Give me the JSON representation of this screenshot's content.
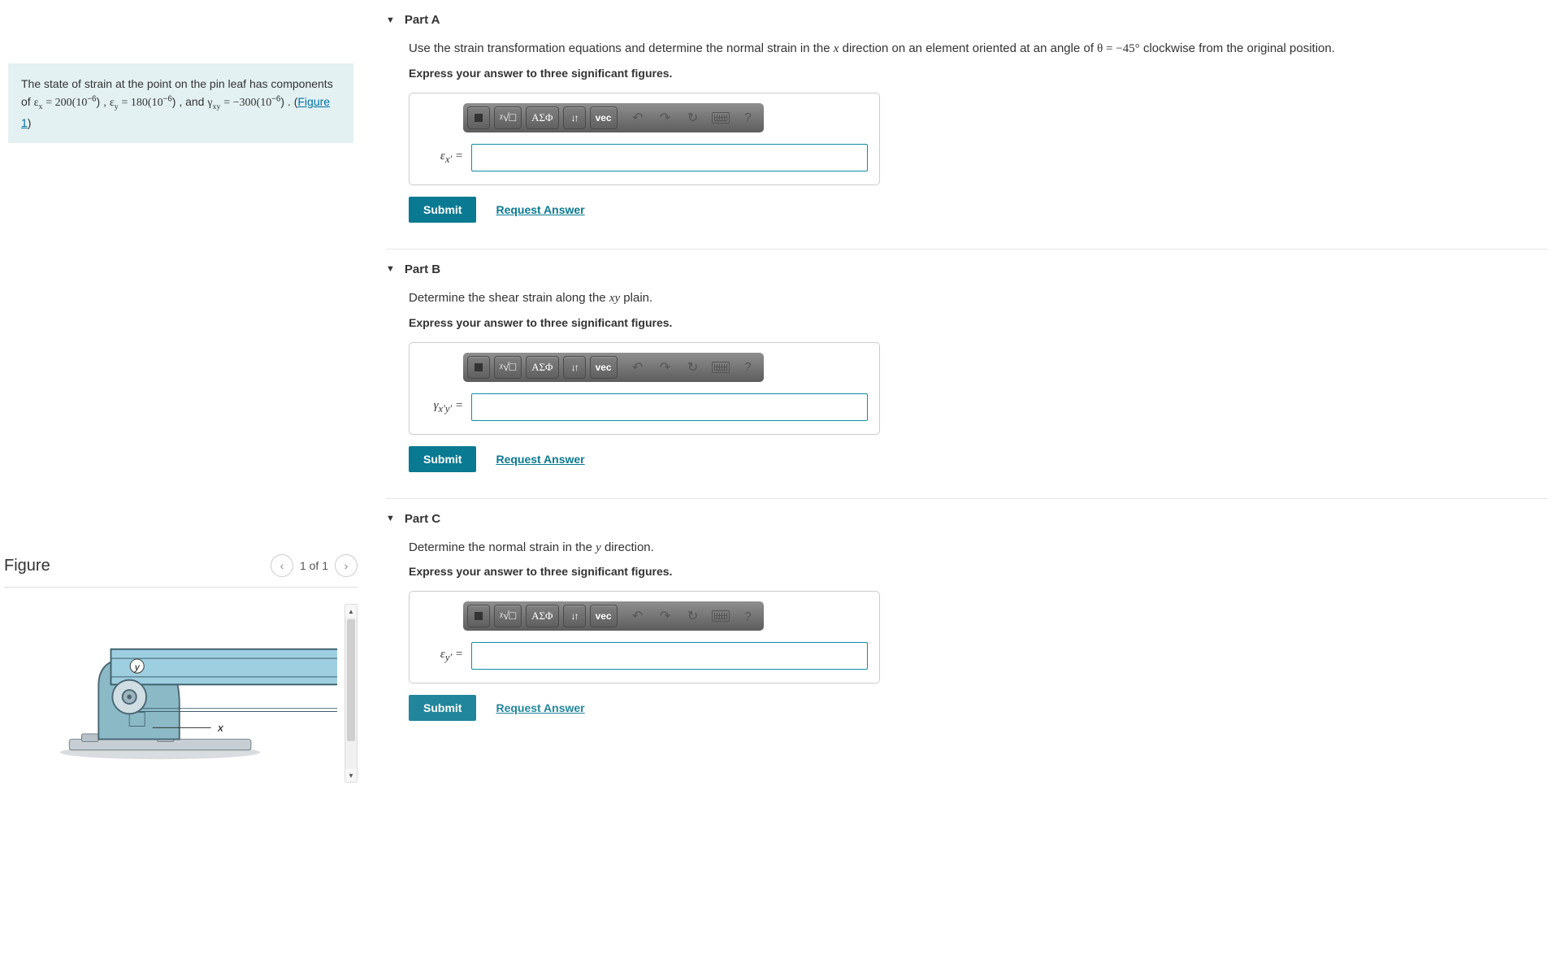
{
  "problem": {
    "intro": "The state of strain at the point on the pin leaf has components of ",
    "eps_x_var": "ε",
    "eps_x_sub": "x",
    "eps_x_eq": " = 200(10",
    "exp_neg6": "−6",
    "close_paren": ")",
    "sep1": " , ",
    "eps_y_var": "ε",
    "eps_y_sub": "y",
    "eps_y_eq": " = 180(10",
    "sep2": " , and ",
    "gamma_var": "γ",
    "gamma_sub": "xy",
    "gamma_eq": " = −300(10",
    "trail": " . (",
    "figure_link": "Figure 1",
    "trail_close": ")"
  },
  "figure_panel": {
    "title": "Figure",
    "pager": "1 of 1",
    "axes": {
      "x": "x",
      "y": "y"
    }
  },
  "parts": {
    "a": {
      "header": "Part A",
      "prompt_pre": "Use the strain transformation equations and determine the normal strain in the ",
      "prompt_var1": "x",
      "prompt_mid": " direction on an element oriented at an angle of ",
      "prompt_theta": "θ = −45°",
      "prompt_post": " clockwise from the original position.",
      "instruct": "Express your answer to three significant figures.",
      "symlabel_html": "ε<sub>x′</sub> ="
    },
    "b": {
      "header": "Part B",
      "prompt_pre": "Determine the shear strain along the ",
      "prompt_var1": "xy",
      "prompt_post": " plain.",
      "instruct": "Express your answer to three significant figures.",
      "symlabel_html": "γ<sub>x′y′</sub> ="
    },
    "c": {
      "header": "Part C",
      "prompt_pre": "Determine the normal strain in the ",
      "prompt_var1": "y",
      "prompt_post": " direction.",
      "instruct": "Express your answer to three significant figures.",
      "symlabel_html": "ε<sub>y′</sub> ="
    }
  },
  "toolbar": {
    "templates": "■",
    "sqrt": "ᵡ√□",
    "greek": "ΑΣΦ",
    "subscript": "↓↑",
    "vec": "vec",
    "undo": "↶",
    "redo": "↷",
    "reset": "↻",
    "keyboard": "⌨",
    "help": "?"
  },
  "actions": {
    "submit": "Submit",
    "request": "Request Answer"
  }
}
